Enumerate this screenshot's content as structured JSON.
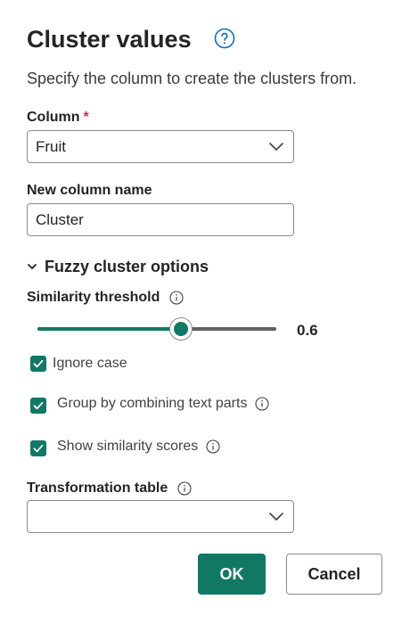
{
  "dialog": {
    "title": "Cluster values",
    "subtitle": "Specify the column to create the clusters from."
  },
  "column": {
    "label": "Column",
    "required_mark": "*",
    "value": "Fruit"
  },
  "new_column": {
    "label": "New column name",
    "value": "Cluster"
  },
  "fuzzy": {
    "section_label": "Fuzzy cluster options",
    "threshold_label": "Similarity threshold",
    "threshold_value": "0.6",
    "threshold_fraction": 0.6,
    "ignore_case_label": "Ignore case",
    "ignore_case_checked": true,
    "group_label": "Group by combining text parts",
    "group_checked": true,
    "scores_label": "Show similarity scores",
    "scores_checked": true,
    "transform_label": "Transformation table",
    "transform_value": ""
  },
  "buttons": {
    "ok": "OK",
    "cancel": "Cancel"
  },
  "colors": {
    "accent": "#117865",
    "required": "#c4314b"
  }
}
